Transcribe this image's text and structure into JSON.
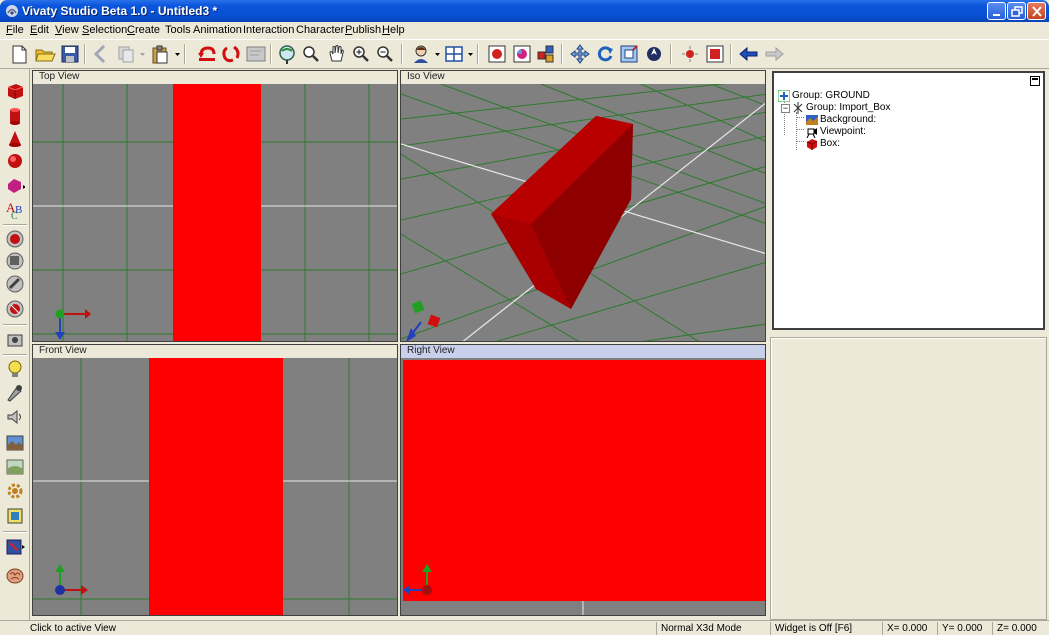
{
  "window": {
    "title": "Vivaty Studio Beta 1.0 - Untitled3 *"
  },
  "menu": [
    {
      "label": "File",
      "hotkey": "F",
      "rest": "ile"
    },
    {
      "label": "Edit",
      "hotkey": "E",
      "rest": "dit"
    },
    {
      "label": "View",
      "hotkey": "V",
      "rest": "iew"
    },
    {
      "label": "Selection",
      "hotkey": "S",
      "rest": "election"
    },
    {
      "label": "Create",
      "hotkey": "C",
      "rest": "reate"
    },
    {
      "label": "Tools",
      "hotkey": "",
      "rest": "Tools"
    },
    {
      "label": "Animation",
      "hotkey": "",
      "rest": "Animation"
    },
    {
      "label": "Interaction",
      "hotkey": "",
      "rest": "Interaction"
    },
    {
      "label": "Character",
      "hotkey": "",
      "rest": "Character"
    },
    {
      "label": "Publish",
      "hotkey": "P",
      "rest": "ublish"
    },
    {
      "label": "Help",
      "hotkey": "H",
      "rest": "elp"
    }
  ],
  "toolbar_icons": [
    "new-file-icon",
    "open-folder-icon",
    "save-icon",
    "cut-icon",
    "copy-icon",
    "paste-icon",
    "undo-icon",
    "redo-icon",
    "select-icon",
    "zoom-extents-icon",
    "zoom-icon",
    "pan-hand-icon",
    "zoom-in-icon",
    "zoom-out-icon",
    "avatar-icon",
    "layout-grid-icon",
    "snapshot-icon",
    "material-icon",
    "group-icon",
    "move-icon",
    "rotate-icon",
    "scale-icon",
    "navigate-icon",
    "light-icon",
    "preview-icon",
    "back-arrow-icon",
    "forward-arrow-icon"
  ],
  "left_toolbar_icons": [
    "box-icon",
    "cylinder-icon",
    "cone-icon",
    "sphere-icon",
    "shape-icon",
    "text-icon",
    "boolean-union-icon",
    "boolean-subtract-icon",
    "boolean-intersect-icon",
    "extrude-icon",
    "camera-objects-icon",
    "light-bulb-icon",
    "spotlight-icon",
    "sound-icon",
    "background-icon",
    "terrain-icon",
    "gear-icon",
    "script-icon",
    "animation-icon",
    "brain-icon"
  ],
  "viewports": {
    "top": {
      "label": "Top View"
    },
    "iso": {
      "label": "Iso View"
    },
    "front": {
      "label": "Front View"
    },
    "right": {
      "label": "Right View"
    }
  },
  "tree": [
    {
      "label": "Group:  GROUND",
      "icon": "group-icon"
    },
    {
      "label": "Group:  Import_Box",
      "icon": "group-icon"
    },
    {
      "label": "Background:",
      "icon": "background-icon"
    },
    {
      "label": "Viewpoint:",
      "icon": "viewpoint-icon"
    },
    {
      "label": "Box:",
      "icon": "box-icon"
    }
  ],
  "status": {
    "message": "Click to active View",
    "mode": "Normal X3d Mode",
    "widget": "Widget is Off  [F6]",
    "x": "X=  0.000",
    "y": "Y=  0.000",
    "z": "Z=  0.000"
  },
  "colors": {
    "object": "#ff0000",
    "object_shade": "#b00000",
    "viewport_bg": "#808080",
    "grid": "#2d7a2d",
    "axis_line": "#e8e8e8"
  }
}
